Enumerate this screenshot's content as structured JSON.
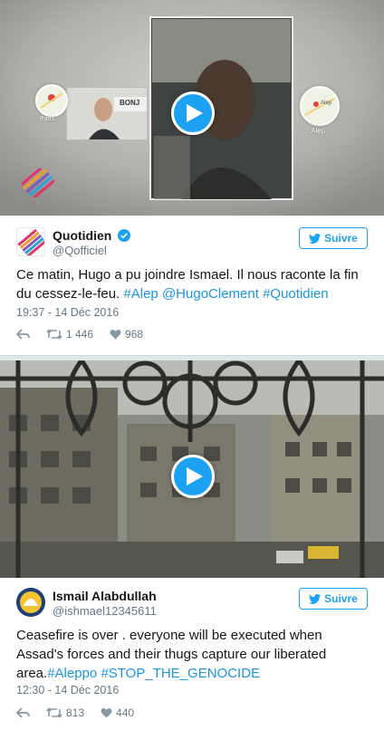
{
  "tweets": [
    {
      "display_name": "Quotidien",
      "handle": "@Qofficiel",
      "follow_label": "Suivre",
      "text_plain": "Ce matin, Hugo a pu joindre Ismael. Il nous raconte la fin du cessez-le-feu.",
      "hashtags": [
        "#Alep",
        "@HugoClement",
        "#Quotidien"
      ],
      "timestamp": "19:37 - 14 Déc 2016",
      "retweets": "1 446",
      "likes": "968",
      "media": {
        "map_left_label": "Paris",
        "map_right_label": "Alep",
        "map_right_city": "Alep",
        "panel_text": "BONJ"
      }
    },
    {
      "display_name": "Ismail Alabdullah",
      "handle": "@ishmael12345611",
      "follow_label": "Suivre",
      "text_plain": "Ceasefire is over . everyone will be executed when Assad's forces and their thugs capture our liberated area.",
      "hashtags": [
        "#Aleppo",
        "#STOP_THE_GENOCIDE"
      ],
      "timestamp": "12:30 - 14 Déc 2016",
      "retweets": "813",
      "likes": "440"
    }
  ],
  "colors": {
    "accent": "#1da1f2",
    "link": "#1b95e0",
    "muted": "#657786",
    "text": "#14171a"
  }
}
